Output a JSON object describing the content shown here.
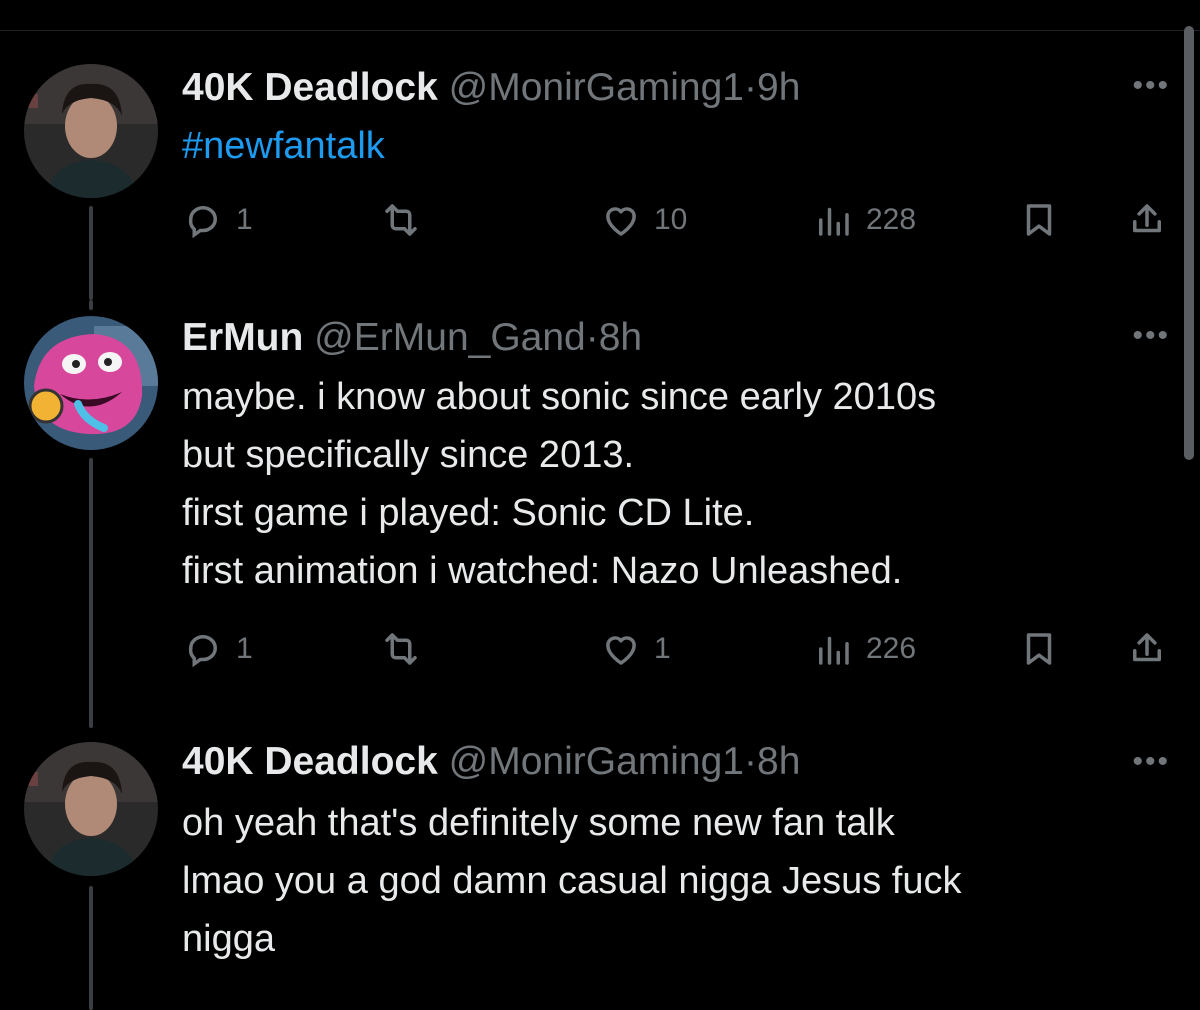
{
  "tweets": [
    {
      "name": "40K Deadlock",
      "handle": "@MonirGaming1",
      "dot": "·",
      "time": "9h",
      "text_lines": [],
      "hashtag": "#newfantalk",
      "reply_count": "1",
      "like_count": "10",
      "view_count": "228"
    },
    {
      "name": "ErMun",
      "handle": "@ErMun_Gand",
      "dot": "·",
      "time": "8h",
      "text_lines": [
        "maybe. i know about sonic since early 2010s",
        "but specifically since 2013.",
        "first game i played: Sonic CD Lite.",
        "first animation i watched: Nazo Unleashed."
      ],
      "reply_count": "1",
      "like_count": "1",
      "view_count": "226"
    },
    {
      "name": "40K Deadlock",
      "handle": "@MonirGaming1",
      "dot": "·",
      "time": "8h",
      "text_lines": [
        "oh yeah that's definitely some new fan talk",
        "lmao you a god damn casual nigga Jesus fuck",
        "nigga"
      ]
    }
  ],
  "more_label": "•••",
  "icons": {
    "reply": "reply-icon",
    "retweet": "retweet-icon",
    "like": "heart-icon",
    "views": "views-icon",
    "bookmark": "bookmark-icon",
    "share": "share-icon"
  },
  "colors": {
    "background": "#000000",
    "text": "#e7e9ea",
    "muted": "#71767b",
    "link": "#1d9bf0"
  }
}
